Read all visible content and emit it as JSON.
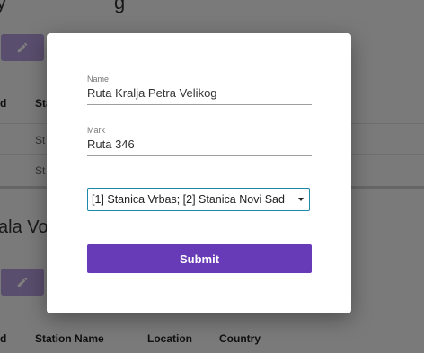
{
  "background": {
    "heading_top": "y",
    "heading_top_tail": "g",
    "heading_mid": "ala Vo",
    "table_top": {
      "col_d": "d",
      "col_sta": "Sta",
      "row1_cell": "St",
      "row2_cell": "St"
    },
    "table_bottom": {
      "col_d": "d",
      "col_station_name": "Station Name",
      "col_location": "Location",
      "col_country": "Country"
    }
  },
  "modal": {
    "name": {
      "label": "Name",
      "value": "Ruta Kralja Petra Velikog"
    },
    "mark": {
      "label": "Mark",
      "value": "Ruta 346"
    },
    "stations_select": {
      "selected": "[1] Stanica Vrbas; [2] Stanica Novi Sad"
    },
    "submit_label": "Submit"
  },
  "colors": {
    "accent": "#673ab7",
    "accent_light": "#b39ddb",
    "select_border": "#1e88a8"
  },
  "icons": {
    "edit": "pencil-icon",
    "dropdown": "chevron-down-icon"
  }
}
